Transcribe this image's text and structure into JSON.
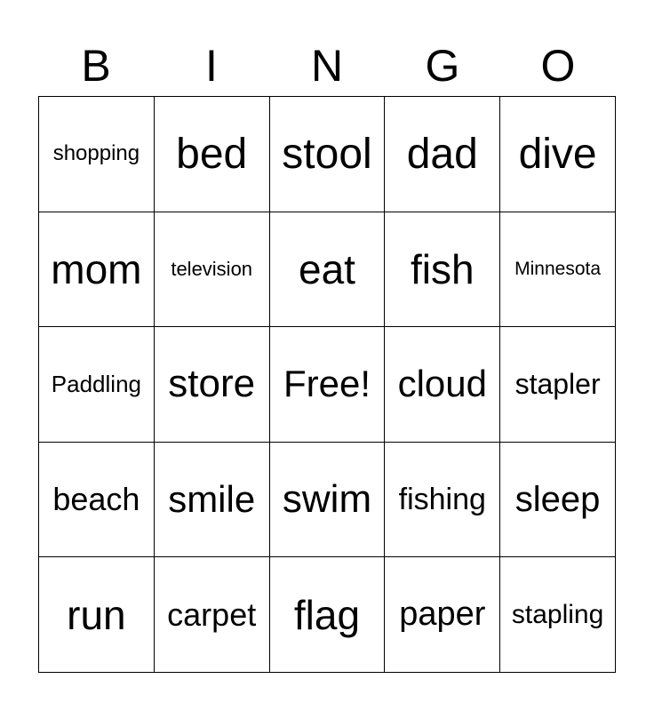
{
  "header": [
    "B",
    "I",
    "N",
    "G",
    "O"
  ],
  "cells": [
    [
      "shopping",
      "bed",
      "stool",
      "dad",
      "dive"
    ],
    [
      "mom",
      "television",
      "eat",
      "fish",
      "Minnesota"
    ],
    [
      "Paddling",
      "store",
      "Free!",
      "cloud",
      "stapler"
    ],
    [
      "beach",
      "smile",
      "swim",
      "fishing",
      "sleep"
    ],
    [
      "run",
      "carpet",
      "flag",
      "paper",
      "stapling"
    ]
  ]
}
